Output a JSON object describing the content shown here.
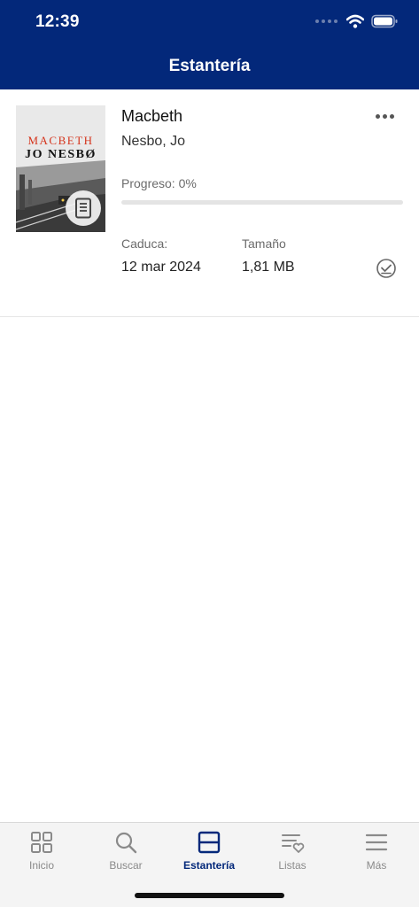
{
  "status_bar": {
    "time": "12:39"
  },
  "header": {
    "title": "Estantería"
  },
  "book": {
    "cover_title": "MACBETH",
    "cover_author": "JO NESBØ",
    "title": "Macbeth",
    "author": "Nesbo, Jo",
    "progress_text": "Progreso: 0%",
    "progress_fraction": 0,
    "expiry_label": "Caduca:",
    "expiry_value": "12 mar 2024",
    "size_label": "Tamaño",
    "size_value": "1,81 MB",
    "format_icon": "document-icon",
    "menu_icon": "more-icon",
    "status_icon": "check-circle-icon"
  },
  "tabs": [
    {
      "label": "Inicio",
      "icon": "grid-icon",
      "active": false
    },
    {
      "label": "Buscar",
      "icon": "search-icon",
      "active": false
    },
    {
      "label": "Estantería",
      "icon": "shelf-icon",
      "active": true
    },
    {
      "label": "Listas",
      "icon": "list-heart-icon",
      "active": false
    },
    {
      "label": "Más",
      "icon": "menu-icon",
      "active": false
    }
  ],
  "colors": {
    "brand": "#03287a",
    "inactive": "#8a8a8a",
    "cover_accent": "#d5341c"
  }
}
